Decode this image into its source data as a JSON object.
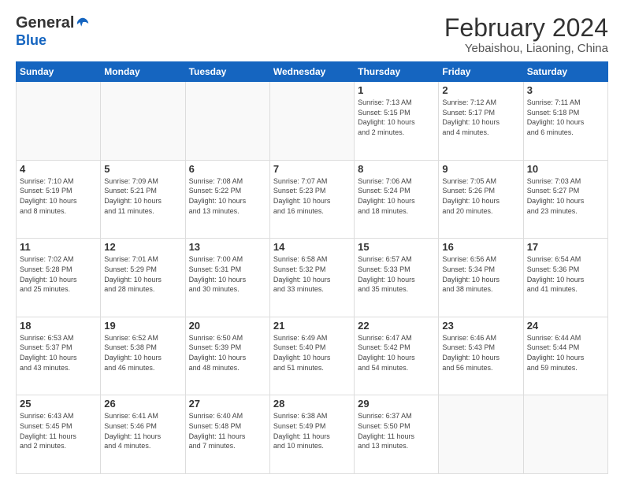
{
  "logo": {
    "general": "General",
    "blue": "Blue"
  },
  "title": {
    "month": "February 2024",
    "location": "Yebaishou, Liaoning, China"
  },
  "weekdays": [
    "Sunday",
    "Monday",
    "Tuesday",
    "Wednesday",
    "Thursday",
    "Friday",
    "Saturday"
  ],
  "weeks": [
    [
      {
        "day": "",
        "info": ""
      },
      {
        "day": "",
        "info": ""
      },
      {
        "day": "",
        "info": ""
      },
      {
        "day": "",
        "info": ""
      },
      {
        "day": "1",
        "info": "Sunrise: 7:13 AM\nSunset: 5:15 PM\nDaylight: 10 hours\nand 2 minutes."
      },
      {
        "day": "2",
        "info": "Sunrise: 7:12 AM\nSunset: 5:17 PM\nDaylight: 10 hours\nand 4 minutes."
      },
      {
        "day": "3",
        "info": "Sunrise: 7:11 AM\nSunset: 5:18 PM\nDaylight: 10 hours\nand 6 minutes."
      }
    ],
    [
      {
        "day": "4",
        "info": "Sunrise: 7:10 AM\nSunset: 5:19 PM\nDaylight: 10 hours\nand 8 minutes."
      },
      {
        "day": "5",
        "info": "Sunrise: 7:09 AM\nSunset: 5:21 PM\nDaylight: 10 hours\nand 11 minutes."
      },
      {
        "day": "6",
        "info": "Sunrise: 7:08 AM\nSunset: 5:22 PM\nDaylight: 10 hours\nand 13 minutes."
      },
      {
        "day": "7",
        "info": "Sunrise: 7:07 AM\nSunset: 5:23 PM\nDaylight: 10 hours\nand 16 minutes."
      },
      {
        "day": "8",
        "info": "Sunrise: 7:06 AM\nSunset: 5:24 PM\nDaylight: 10 hours\nand 18 minutes."
      },
      {
        "day": "9",
        "info": "Sunrise: 7:05 AM\nSunset: 5:26 PM\nDaylight: 10 hours\nand 20 minutes."
      },
      {
        "day": "10",
        "info": "Sunrise: 7:03 AM\nSunset: 5:27 PM\nDaylight: 10 hours\nand 23 minutes."
      }
    ],
    [
      {
        "day": "11",
        "info": "Sunrise: 7:02 AM\nSunset: 5:28 PM\nDaylight: 10 hours\nand 25 minutes."
      },
      {
        "day": "12",
        "info": "Sunrise: 7:01 AM\nSunset: 5:29 PM\nDaylight: 10 hours\nand 28 minutes."
      },
      {
        "day": "13",
        "info": "Sunrise: 7:00 AM\nSunset: 5:31 PM\nDaylight: 10 hours\nand 30 minutes."
      },
      {
        "day": "14",
        "info": "Sunrise: 6:58 AM\nSunset: 5:32 PM\nDaylight: 10 hours\nand 33 minutes."
      },
      {
        "day": "15",
        "info": "Sunrise: 6:57 AM\nSunset: 5:33 PM\nDaylight: 10 hours\nand 35 minutes."
      },
      {
        "day": "16",
        "info": "Sunrise: 6:56 AM\nSunset: 5:34 PM\nDaylight: 10 hours\nand 38 minutes."
      },
      {
        "day": "17",
        "info": "Sunrise: 6:54 AM\nSunset: 5:36 PM\nDaylight: 10 hours\nand 41 minutes."
      }
    ],
    [
      {
        "day": "18",
        "info": "Sunrise: 6:53 AM\nSunset: 5:37 PM\nDaylight: 10 hours\nand 43 minutes."
      },
      {
        "day": "19",
        "info": "Sunrise: 6:52 AM\nSunset: 5:38 PM\nDaylight: 10 hours\nand 46 minutes."
      },
      {
        "day": "20",
        "info": "Sunrise: 6:50 AM\nSunset: 5:39 PM\nDaylight: 10 hours\nand 48 minutes."
      },
      {
        "day": "21",
        "info": "Sunrise: 6:49 AM\nSunset: 5:40 PM\nDaylight: 10 hours\nand 51 minutes."
      },
      {
        "day": "22",
        "info": "Sunrise: 6:47 AM\nSunset: 5:42 PM\nDaylight: 10 hours\nand 54 minutes."
      },
      {
        "day": "23",
        "info": "Sunrise: 6:46 AM\nSunset: 5:43 PM\nDaylight: 10 hours\nand 56 minutes."
      },
      {
        "day": "24",
        "info": "Sunrise: 6:44 AM\nSunset: 5:44 PM\nDaylight: 10 hours\nand 59 minutes."
      }
    ],
    [
      {
        "day": "25",
        "info": "Sunrise: 6:43 AM\nSunset: 5:45 PM\nDaylight: 11 hours\nand 2 minutes."
      },
      {
        "day": "26",
        "info": "Sunrise: 6:41 AM\nSunset: 5:46 PM\nDaylight: 11 hours\nand 4 minutes."
      },
      {
        "day": "27",
        "info": "Sunrise: 6:40 AM\nSunset: 5:48 PM\nDaylight: 11 hours\nand 7 minutes."
      },
      {
        "day": "28",
        "info": "Sunrise: 6:38 AM\nSunset: 5:49 PM\nDaylight: 11 hours\nand 10 minutes."
      },
      {
        "day": "29",
        "info": "Sunrise: 6:37 AM\nSunset: 5:50 PM\nDaylight: 11 hours\nand 13 minutes."
      },
      {
        "day": "",
        "info": ""
      },
      {
        "day": "",
        "info": ""
      }
    ]
  ]
}
